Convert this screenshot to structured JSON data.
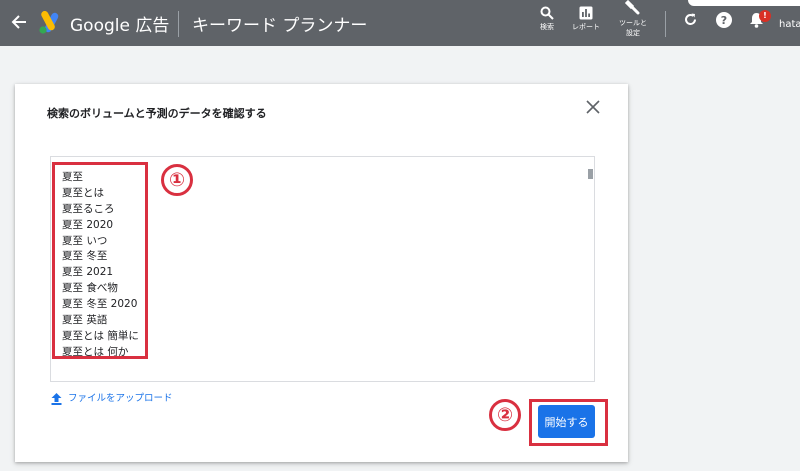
{
  "header": {
    "brand": "Google 広告",
    "page_title": "キーワード プランナー",
    "search_label": "検索",
    "reports_label": "レポート",
    "tools_label_line1": "ツールと",
    "tools_label_line2": "設定",
    "notification_count": "!",
    "user": "hata"
  },
  "dialog": {
    "title": "検索のボリュームと予測のデータを確認する",
    "keywords": [
      "夏至",
      "夏至とは",
      "夏至るころ",
      "夏至 2020",
      "夏至 いつ",
      "夏至 冬至",
      "夏至 2021",
      "夏至 食べ物",
      "夏至 冬至 2020",
      "夏至 英語",
      "夏至とは 簡単に",
      "夏至とは 何か"
    ],
    "upload_label": "ファイルをアップロード",
    "start_label": "開始する"
  },
  "annotations": {
    "marker1": "①",
    "marker2": "②"
  },
  "colors": {
    "topbar": "#5f6368",
    "accent": "#1a73e8",
    "annotation_red": "#d93040"
  }
}
